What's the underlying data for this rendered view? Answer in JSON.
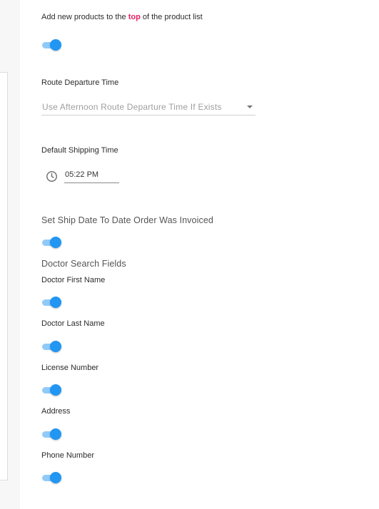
{
  "settings": {
    "add_products_prefix": "Add new products to the ",
    "add_products_highlight": "top",
    "add_products_suffix": " of the product list",
    "route_departure_label": "Route Departure Time",
    "route_departure_value": "Use Afternoon Route Departure Time If Exists",
    "default_shipping_label": "Default Shipping Time",
    "default_shipping_value": "05:22 PM",
    "ship_date_label": "Set Ship Date To Date Order Was Invoiced",
    "doctor_search_heading": "Doctor Search Fields",
    "doctor_first_name_label": "Doctor First Name",
    "doctor_last_name_label": "Doctor Last Name",
    "license_number_label": "License Number",
    "address_label": "Address",
    "phone_number_label": "Phone Number"
  },
  "toggles": {
    "add_to_top": true,
    "ship_date_invoiced": true,
    "doctor_first_name": true,
    "doctor_last_name": true,
    "license_number": true,
    "address": true,
    "phone_number": true
  },
  "icons": {
    "clock": "clock-icon",
    "dropdown": "chevron-down-icon"
  },
  "colors": {
    "accent": "#2196f3",
    "accent_track": "#90caf9",
    "highlight": "#e91e63"
  }
}
